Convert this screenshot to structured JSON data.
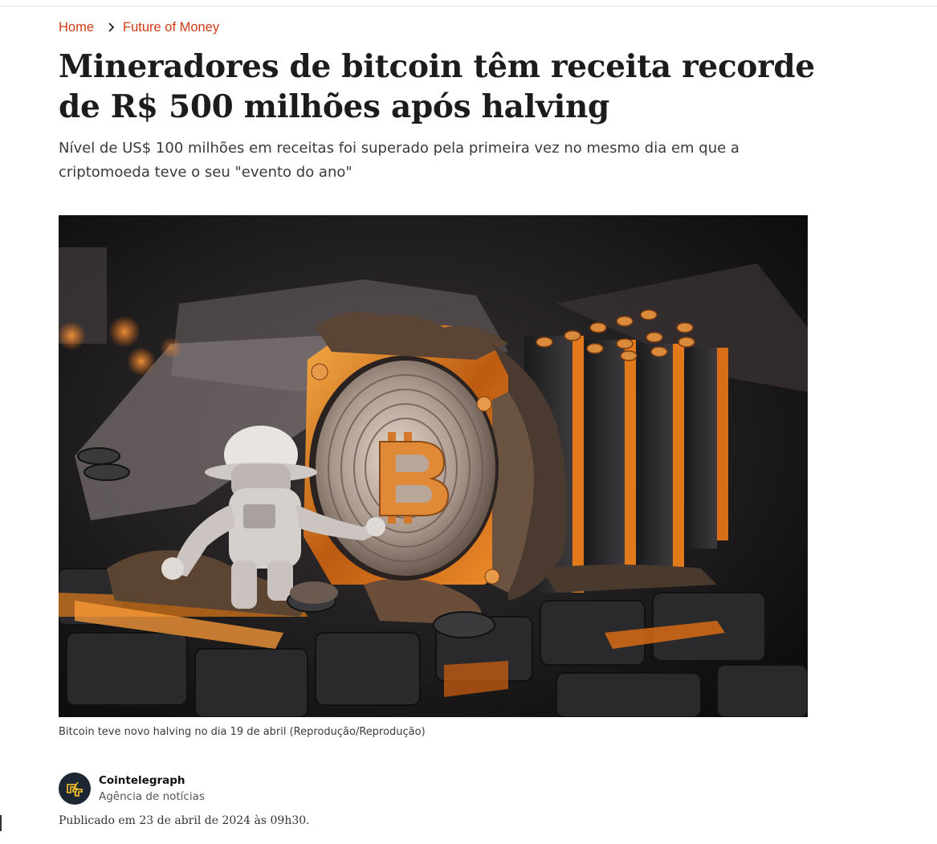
{
  "breadcrumb": {
    "home": "Home",
    "section": "Future of Money"
  },
  "article": {
    "title": "Mineradores de bitcoin têm receita recorde de R$ 500 milhões após halving",
    "subtitle": "Nível de US$ 100 milhões em receitas foi superado pela primeira vez no mesmo dia em que a criptomoeda teve o seu \"evento do ano\"",
    "image_caption": "Bitcoin teve novo halving no dia 19 de abril (Reprodução/Reprodução)",
    "author": {
      "name": "Cointelegraph",
      "role": "Agência de notícias"
    },
    "published": "Publicado em 23 de abril de 2024 às 09h30."
  },
  "colors": {
    "accent": "#d43a12",
    "title": "#1c1c1c",
    "avatar_bg": "#1c2733",
    "orange_glow": "#f08a1c"
  },
  "icons": {
    "breadcrumb_separator": "chevron-right-icon",
    "author_logo": "cointelegraph-logo-icon"
  }
}
